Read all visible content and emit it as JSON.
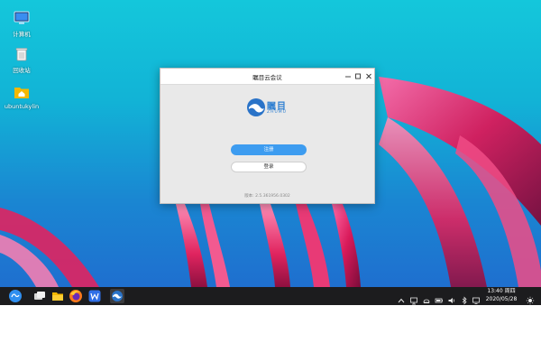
{
  "desktop": {
    "icons": [
      {
        "label": "计算机",
        "icon": "computer-icon"
      },
      {
        "label": "回收站",
        "icon": "trash-icon"
      },
      {
        "label": "ubuntukylin",
        "icon": "home-folder-icon"
      }
    ]
  },
  "dialog": {
    "title": "瞩目云会议",
    "logo": {
      "name": "瞩目",
      "sub": "ZHUMU"
    },
    "register_label": "注册",
    "login_label": "登录",
    "version": "版本: 2.5.361956.0302",
    "controls": [
      "minimize-icon",
      "maximize-icon",
      "close-icon"
    ],
    "accent": "#3d9cf0"
  },
  "taskbar": {
    "items": [
      "start-menu-icon",
      "multitask-view-icon",
      "file-manager-icon",
      "firefox-icon",
      "wps-writer-icon",
      "zhumu-app-icon"
    ],
    "tray": [
      "tray-expand-icon",
      "network-icon",
      "clipboard-icon",
      "battery-icon",
      "volume-icon",
      "bluetooth-icon",
      "display-icon"
    ],
    "time": "13:40 周四",
    "date": "2020/05/28"
  }
}
